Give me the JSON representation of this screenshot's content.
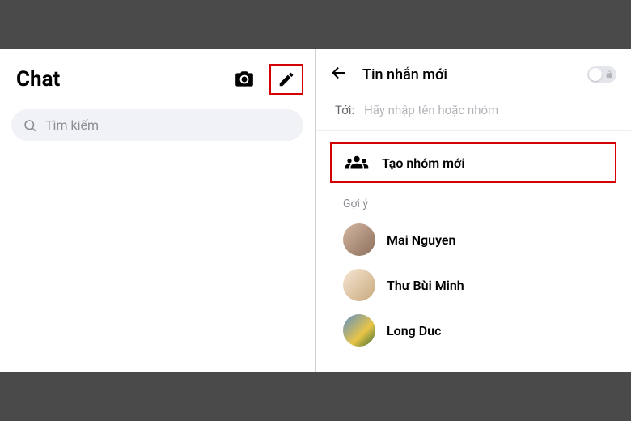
{
  "left": {
    "title": "Chat",
    "search_placeholder": "Tìm kiếm"
  },
  "right": {
    "title": "Tin nhắn mới",
    "to_label": "Tới:",
    "to_placeholder": "Hãy nhập tên hoặc nhóm",
    "create_group_label": "Tạo nhóm mới",
    "suggestions_label": "Gợi ý",
    "contacts": [
      {
        "name": "Mai Nguyen"
      },
      {
        "name": "Thư Bùi Minh"
      },
      {
        "name": "Long Duc"
      }
    ]
  },
  "colors": {
    "highlight": "#d40000"
  }
}
